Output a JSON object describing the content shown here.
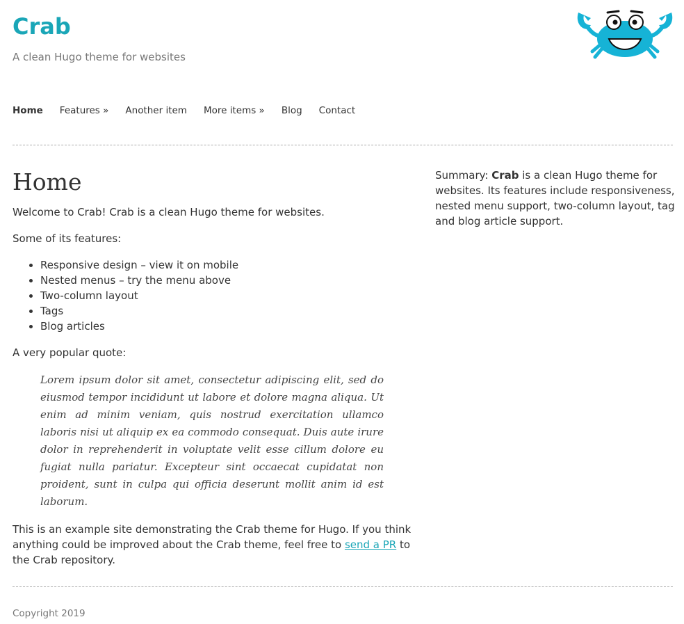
{
  "header": {
    "site_title": "Crab",
    "tagline": "A clean Hugo theme for websites",
    "logo_icon": "crab-logo-icon",
    "accent_color": "#1aa6b7"
  },
  "nav": {
    "items": [
      {
        "label": "Home",
        "active": true
      },
      {
        "label": "Features »"
      },
      {
        "label": "Another item"
      },
      {
        "label": "More items »"
      },
      {
        "label": "Blog"
      },
      {
        "label": "Contact"
      }
    ]
  },
  "main": {
    "heading": "Home",
    "intro": "Welcome to Crab! Crab is a clean Hugo theme for websites.",
    "features_intro": "Some of its features:",
    "features": [
      "Responsive design – view it on mobile",
      "Nested menus – try the menu above",
      "Two-column layout",
      "Tags",
      "Blog articles"
    ],
    "quote_intro": "A very popular quote:",
    "quote": "Lorem ipsum dolor sit amet, consectetur adipiscing elit, sed do eiusmod tempor incididunt ut labore et dolore magna aliqua. Ut enim ad minim veniam, quis nostrud exercitation ullamco laboris nisi ut aliquip ex ea commodo consequat. Duis aute irure dolor in reprehenderit in voluptate velit esse cillum dolore eu fugiat nulla pariatur. Excepteur sint occaecat cupidatat non proident, sunt in culpa qui officia deserunt mollit anim id est laborum.",
    "closing_before": "This is an example site demonstrating the Crab theme for Hugo. If you think anything could be improved about the Crab theme, feel free to ",
    "closing_link": "send a PR",
    "closing_after": " to the Crab repository."
  },
  "sidebar": {
    "summary_label": "Summary: ",
    "summary_bold": "Crab",
    "summary_text": " is a clean Hugo theme for websites. Its features include responsiveness, nested menu support, two-column layout, tag and blog article support."
  },
  "footer": {
    "copyright": "Copyright 2019"
  }
}
